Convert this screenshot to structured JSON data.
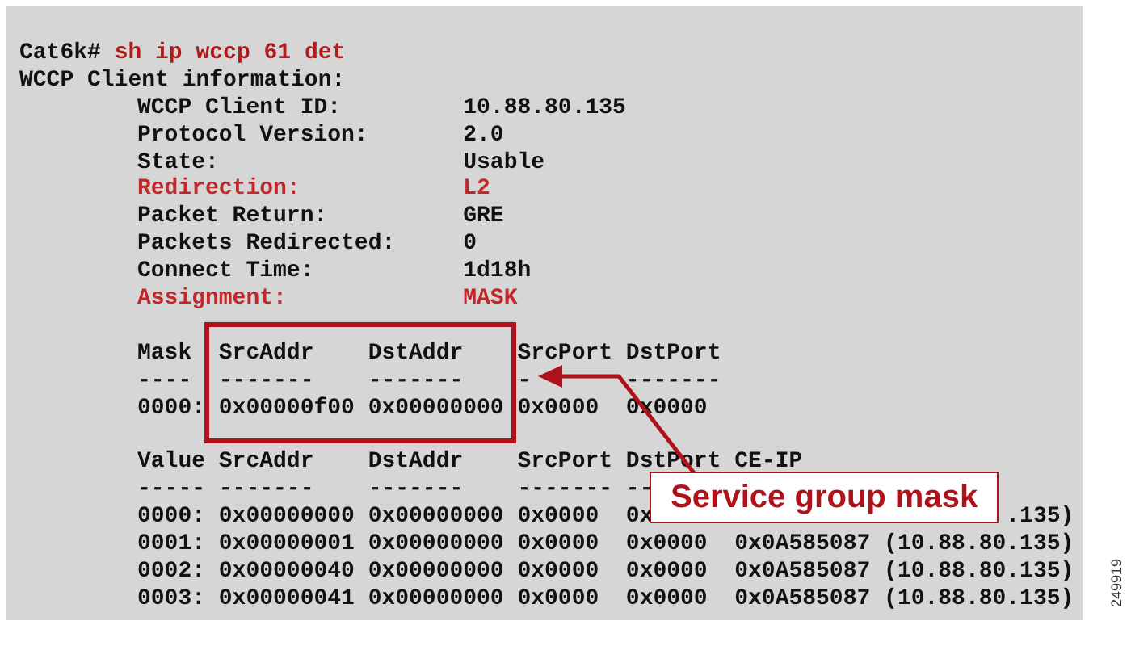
{
  "prompt": "Cat6k#",
  "command": "sh ip wccp 61 det",
  "heading": "WCCP Client information:",
  "fields": [
    {
      "label": "WCCP Client ID:",
      "value": "10.88.80.135",
      "highlight": false
    },
    {
      "label": "Protocol Version:",
      "value": "2.0",
      "highlight": false
    },
    {
      "label": "State:",
      "value": "Usable",
      "highlight": false
    },
    {
      "label": "Redirection:",
      "value": "L2",
      "highlight": true
    },
    {
      "label": "Packet Return:",
      "value": "GRE",
      "highlight": false
    },
    {
      "label": "Packets Redirected:",
      "value": "0",
      "highlight": false
    },
    {
      "label": "Connect Time:",
      "value": "1d18h",
      "highlight": false
    },
    {
      "label": "Assignment:",
      "value": "MASK",
      "highlight": true
    }
  ],
  "mask_table": {
    "header": [
      "Mask",
      "SrcAddr",
      "DstAddr",
      "SrcPort",
      "DstPort"
    ],
    "rule": [
      "----",
      "-------",
      "-------",
      "-",
      "-------"
    ],
    "rows": [
      [
        "0000:",
        "0x00000f00",
        "0x00000000",
        "0x0000",
        "0x0000"
      ]
    ]
  },
  "value_table": {
    "header": [
      "Value",
      "SrcAddr",
      "DstAddr",
      "SrcPort",
      "DstPort",
      "CE-IP"
    ],
    "rule": [
      "-----",
      "-------",
      "-------",
      "-------",
      "--"
    ],
    "rows": [
      [
        "0000:",
        "0x00000000",
        "0x00000000",
        "0x0000",
        "0x",
        ".135)"
      ],
      [
        "0001:",
        "0x00000001",
        "0x00000000",
        "0x0000",
        "0x0000",
        "0x0A585087 (10.88.80.135)"
      ],
      [
        "0002:",
        "0x00000040",
        "0x00000000",
        "0x0000",
        "0x0000",
        "0x0A585087 (10.88.80.135)"
      ],
      [
        "0003:",
        "0x00000041",
        "0x00000000",
        "0x0000",
        "0x0000",
        "0x0A585087 (10.88.80.135)"
      ]
    ]
  },
  "callout": "Service group mask",
  "figure_id": "249919"
}
